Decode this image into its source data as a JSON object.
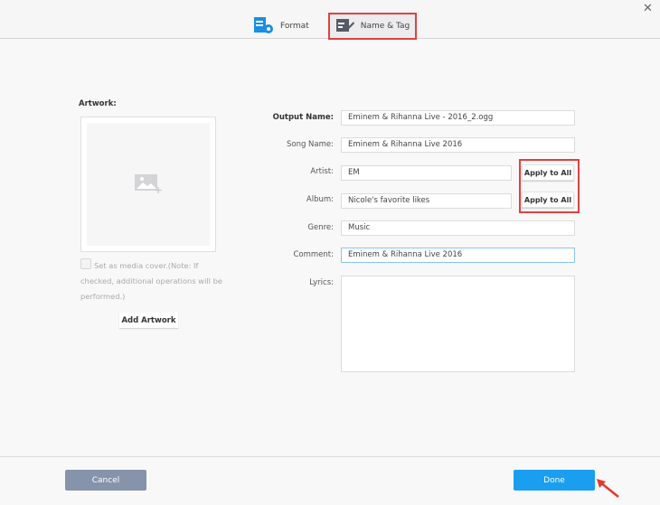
{
  "tabs": [
    {
      "label": "Format"
    },
    {
      "label": "Name & Tag"
    }
  ],
  "artwork": {
    "label": "Artwork:",
    "checkbox_text": "Set as media cover.(Note: If checked, additional operations will be performed.)",
    "add_button": "Add Artwork"
  },
  "form": {
    "output_name": {
      "label": "Output Name:",
      "value": "Eminem & Rihanna Live - 2016_2.ogg"
    },
    "song_name": {
      "label": "Song Name:",
      "value": "Eminem & Rihanna Live 2016"
    },
    "artist": {
      "label": "Artist:",
      "value": "EM"
    },
    "album": {
      "label": "Album:",
      "value": "Nicole's favorite likes"
    },
    "genre": {
      "label": "Genre:",
      "value": "Music"
    },
    "comment": {
      "label": "Comment:",
      "value": "Eminem & Rihanna Live 2016"
    },
    "lyrics": {
      "label": "Lyrics:",
      "value": ""
    },
    "apply_label": "Apply to All"
  },
  "footer": {
    "cancel": "Cancel",
    "done": "Done"
  },
  "colors": {
    "accent": "#1a9ff0",
    "cancel": "#8593ab",
    "highlight": "#e04040"
  }
}
